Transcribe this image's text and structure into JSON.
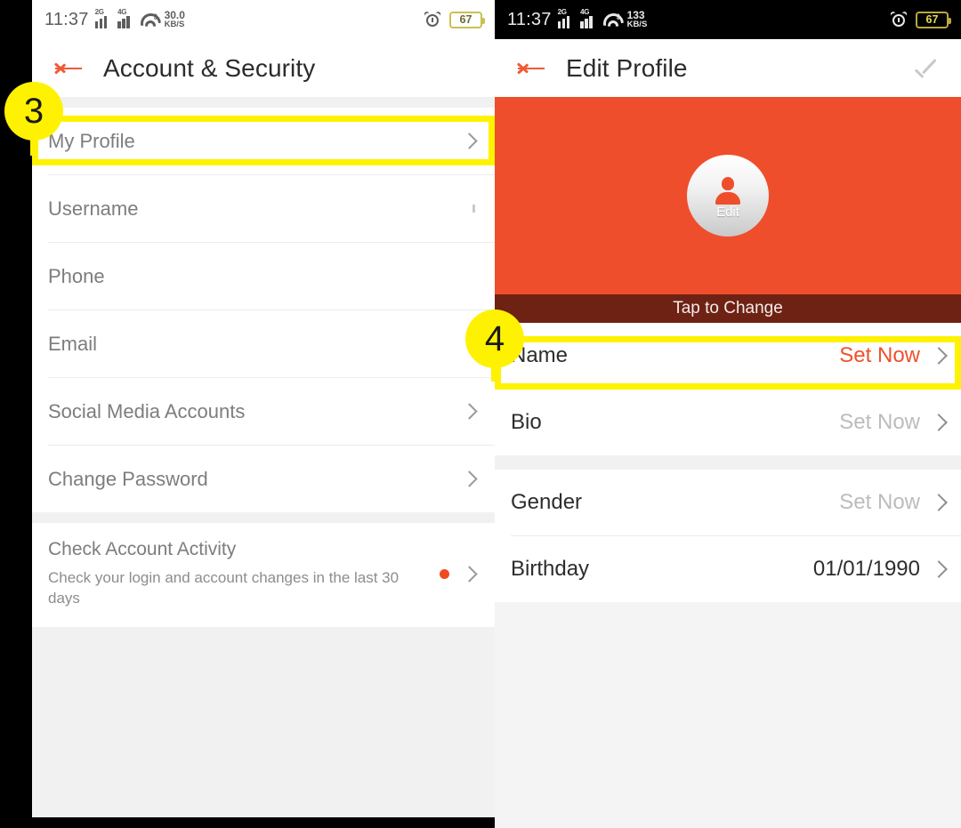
{
  "left_screen": {
    "status_bar": {
      "time": "11:37",
      "signal_1_label": "2G",
      "signal_2_label": "4G",
      "net_speed_value": "30.0",
      "net_speed_unit": "KB/S",
      "alarm_icon": "alarm-icon",
      "battery_level": "67"
    },
    "app_bar": {
      "back_icon": "back-arrow-icon",
      "title": "Account & Security"
    },
    "items": [
      {
        "label": "My Profile",
        "accessory": "chevron"
      },
      {
        "label": "Username",
        "accessory": "tiny-mark"
      },
      {
        "label": "Phone",
        "accessory": "none"
      },
      {
        "label": "Email",
        "accessory": "none"
      },
      {
        "label": "Social Media Accounts",
        "accessory": "chevron"
      },
      {
        "label": "Change Password",
        "accessory": "chevron"
      }
    ],
    "activity": {
      "title": "Check Account Activity",
      "subtitle": "Check your login and account changes in the last 30 days",
      "dot_color": "#f04a22",
      "accessory": "chevron"
    }
  },
  "right_screen": {
    "status_bar": {
      "time": "11:37",
      "signal_1_label": "2G",
      "signal_2_label": "4G",
      "net_speed_value": "133",
      "net_speed_unit": "KB/S",
      "alarm_icon": "alarm-icon",
      "battery_level": "67"
    },
    "app_bar": {
      "back_icon": "back-arrow-icon",
      "title": "Edit Profile",
      "confirm_icon": "check-icon"
    },
    "hero": {
      "background_color": "#ef4e2c",
      "avatar_icon": "person-icon",
      "avatar_edit_label": "Edit",
      "tap_to_change_label": "Tap to Change"
    },
    "items": [
      {
        "label": "Name",
        "value": "Set Now",
        "value_style": "accent"
      },
      {
        "label": "Bio",
        "value": "Set Now",
        "value_style": "muted"
      },
      {
        "label": "Gender",
        "value": "Set Now",
        "value_style": "muted"
      },
      {
        "label": "Birthday",
        "value": "01/01/1990",
        "value_style": "solid"
      }
    ]
  },
  "annotations": {
    "badge_3": "3",
    "badge_4": "4",
    "highlight_color": "#fff200"
  }
}
